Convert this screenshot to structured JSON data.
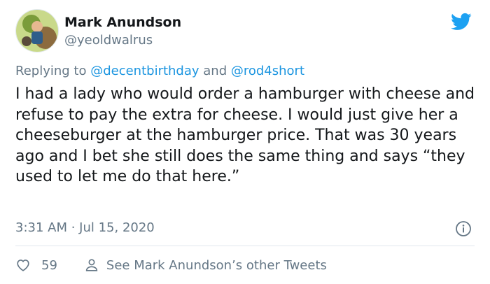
{
  "tweet": {
    "author_name": "Mark Anundson",
    "author_handle": "@yeoldwalrus",
    "replying_prefix": "Replying to ",
    "replying_to": [
      "@decentbirthday",
      "@rod4short"
    ],
    "replying_conjunction": " and ",
    "body": "I had a lady who would order a hamburger with cheese and refuse to pay the extra for cheese. I would just give her a cheeseburger at the hamburger price. That was 30 years ago and I bet she still does the same thing and says “they used to let me do that here.”",
    "timestamp": "3:31 AM · Jul 15, 2020",
    "like_count": "59",
    "see_other_tweets": "See Mark Anundson’s other Tweets"
  },
  "colors": {
    "brand": "#1da1f2",
    "link": "#1b95e0",
    "secondary_text": "#657786",
    "primary_text": "#14171a",
    "divider": "#e1e8ed"
  },
  "icons": [
    "avatar",
    "twitter-bird-icon",
    "info-icon",
    "heart-icon",
    "person-icon"
  ]
}
